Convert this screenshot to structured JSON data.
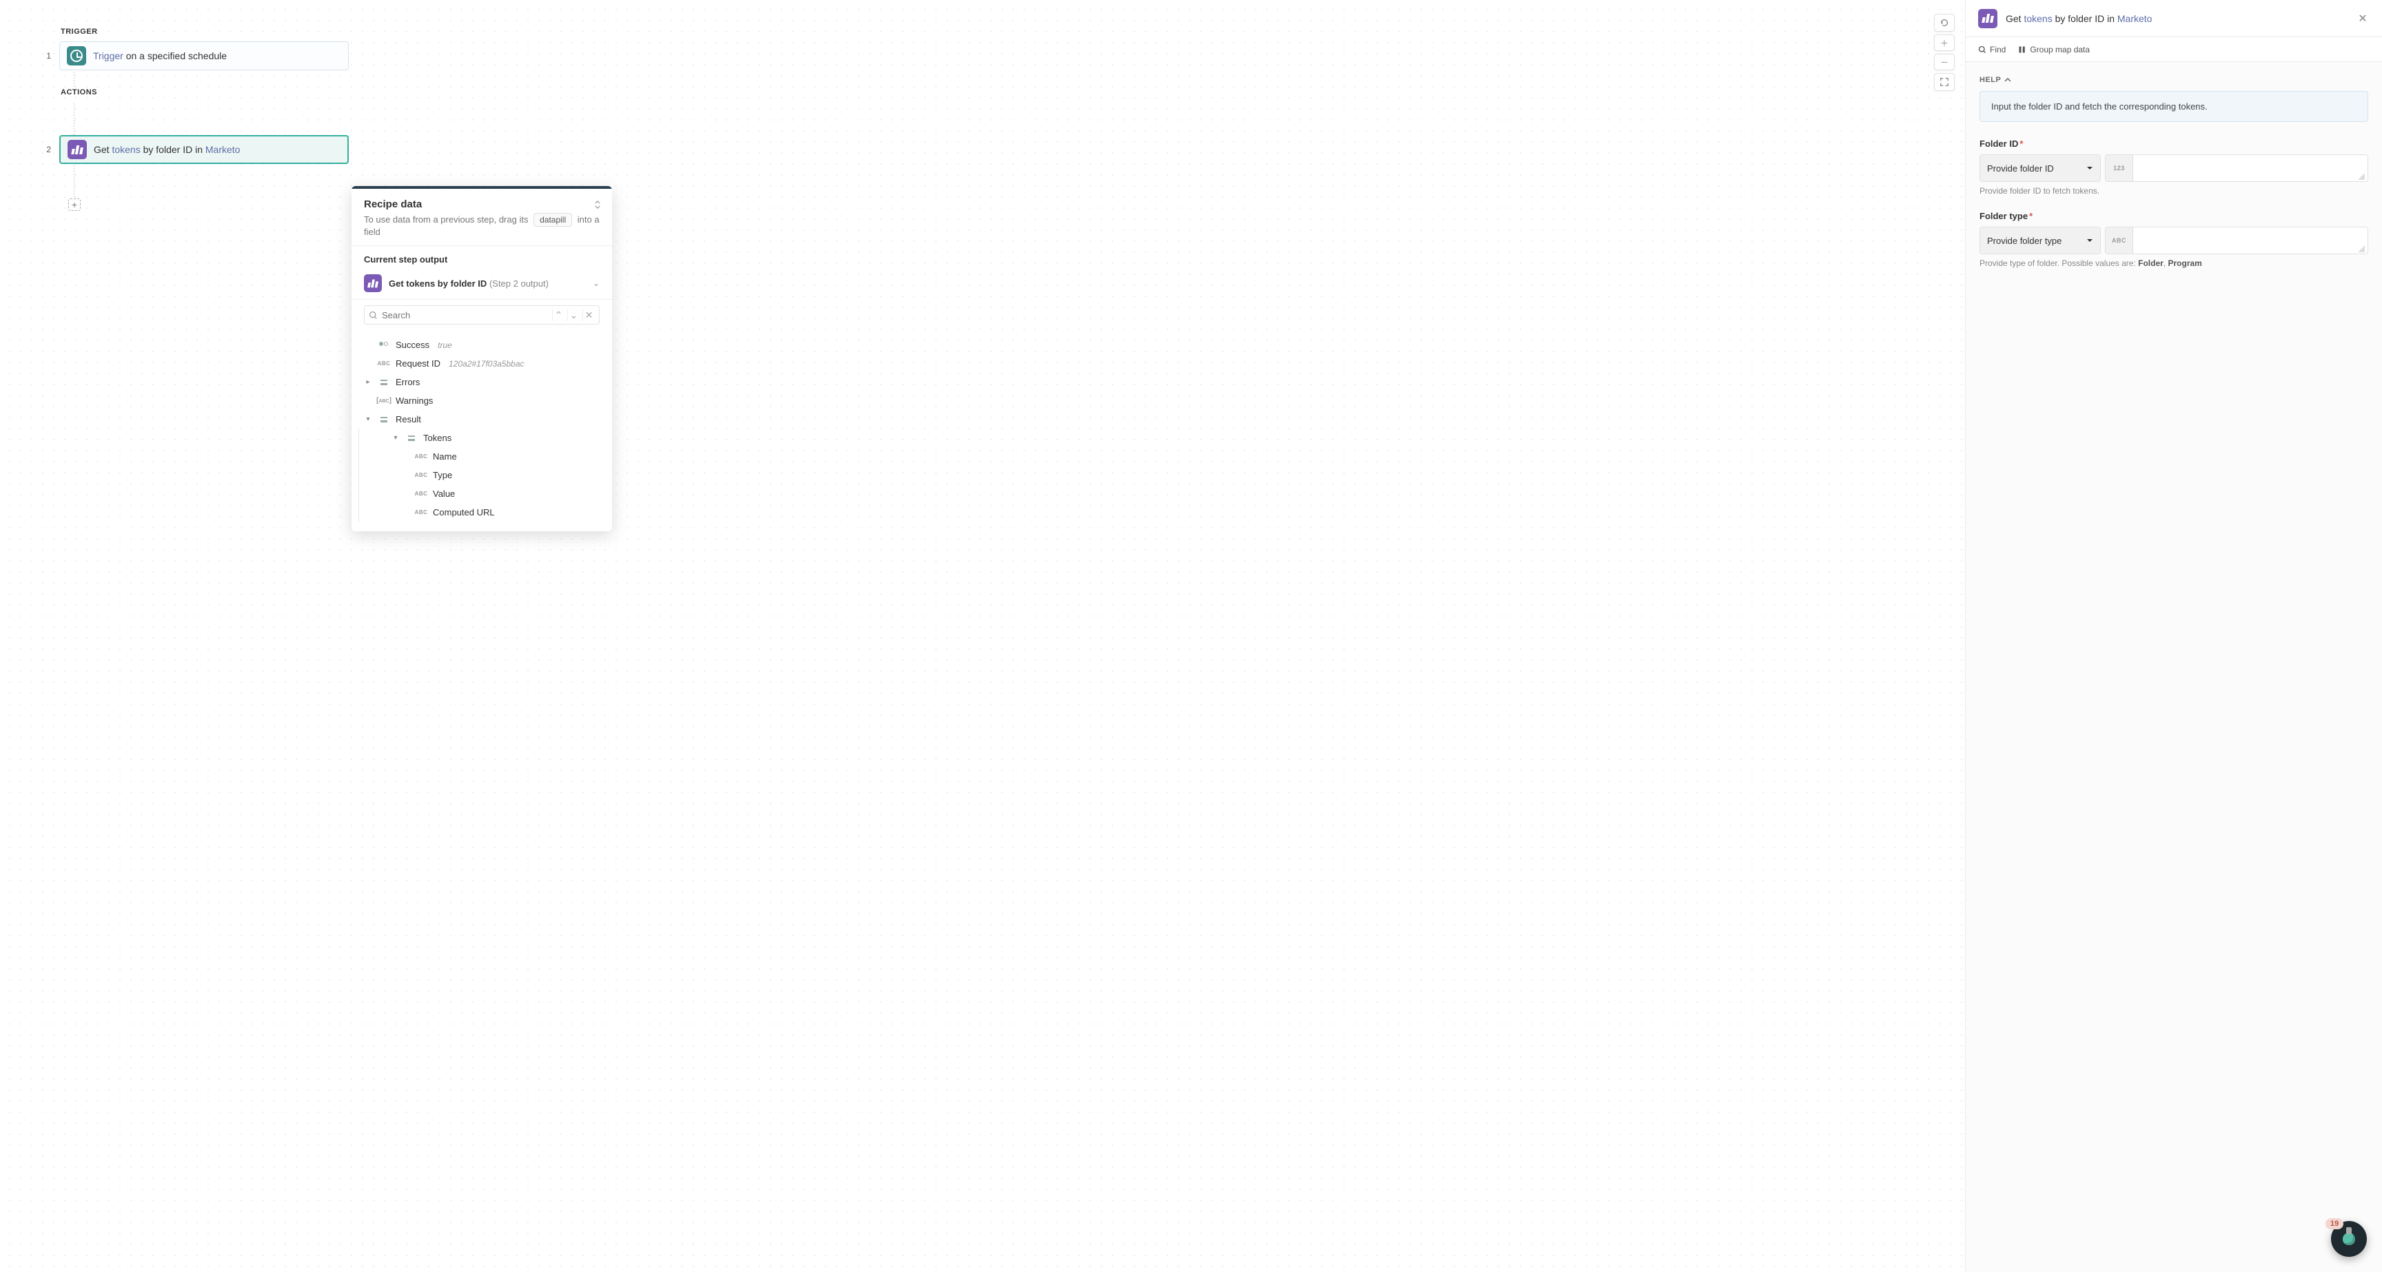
{
  "canvas": {
    "section_trigger": "TRIGGER",
    "section_actions": "ACTIONS",
    "step1_num": "1",
    "step1_text_pre": "Trigger",
    "step1_text_post": " on a specified schedule",
    "step2_num": "2",
    "step2_pre": "Get ",
    "step2_hl1": "tokens",
    "step2_mid": " by folder ID in ",
    "step2_hl2": "Marketo",
    "add_label": "+"
  },
  "recipe": {
    "title": "Recipe data",
    "sub_pre": "To use data from a previous step, drag its",
    "pill": "datapill",
    "sub_post": "into a field",
    "current_step": "Current step output",
    "output_name": "Get tokens by folder ID",
    "output_meta": "(Step 2 output)",
    "search_ph": "Search",
    "tree": {
      "success": "Success",
      "success_val": "true",
      "reqid": "Request ID",
      "reqid_val": "120a2#17f03a5bbac",
      "errors": "Errors",
      "warnings": "Warnings",
      "result": "Result",
      "tokens": "Tokens",
      "name": "Name",
      "type": "Type",
      "value": "Value",
      "computed": "Computed URL"
    }
  },
  "config": {
    "title_pre": "Get ",
    "title_hl1": "tokens",
    "title_mid": " by folder ID in ",
    "title_hl2": "Marketo",
    "find": "Find",
    "group": "Group map data",
    "help_label": "HELP",
    "help_text": "Input the folder ID and fetch the corresponding tokens.",
    "fid_label": "Folder ID",
    "fid_select": "Provide folder ID",
    "fid_prefix": "123",
    "fid_helper": "Provide folder ID to fetch tokens.",
    "ft_label": "Folder type",
    "ft_select": "Provide folder type",
    "ft_prefix": "ABC",
    "ft_helper_pre": "Provide type of folder. Possible values are: ",
    "ft_b1": "Folder",
    "ft_sep": ", ",
    "ft_b2": "Program"
  },
  "float": {
    "badge": "19"
  }
}
